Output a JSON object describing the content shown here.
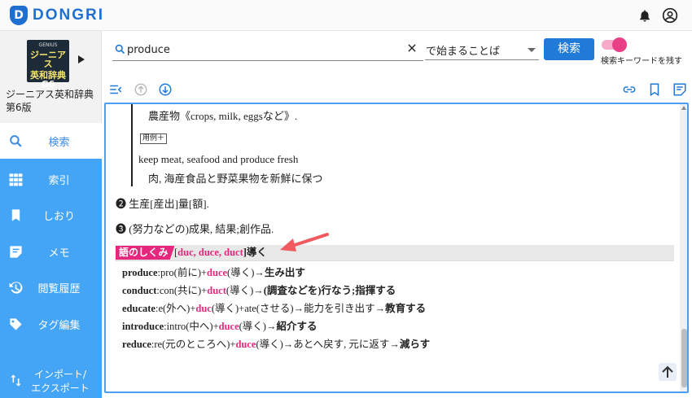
{
  "app": {
    "name": "DONGRI",
    "logo_letter": "D"
  },
  "dictionary": {
    "cover_top": "GENIUS",
    "cover_line1": "ジーニアス",
    "cover_line2": "英和辞典",
    "cover_line3": "G6",
    "name_line1": "ジーニアス英和辞典",
    "name_line2": "第6版"
  },
  "nav": [
    {
      "label": "検索",
      "icon": "search-icon",
      "active": true
    },
    {
      "label": "索引",
      "icon": "grid-icon"
    },
    {
      "label": "しおり",
      "icon": "bookmark-icon"
    },
    {
      "label": "メモ",
      "icon": "memo-icon"
    },
    {
      "label": "閲覧履歴",
      "icon": "history-icon"
    },
    {
      "label": "タグ編集",
      "icon": "tag-icon"
    },
    {
      "label_line1": "インポート/",
      "label_line2": "エクスポート",
      "icon": "import-export-icon"
    }
  ],
  "search": {
    "value": "produce",
    "mode": "で始まることば",
    "button": "検索",
    "keep_keyword_label": "検索キーワードを残す",
    "keep_keyword_on": true
  },
  "entry": {
    "line_crops": "農産物《crops, milk, eggsなど》.",
    "example_tag": "用例＋",
    "example_en": "keep meat, seafood and produce fresh",
    "example_ja": "肉, 海産食品と野菜果物を新鮮に保つ",
    "sense2_num": "❷",
    "sense2": "生産[産出]量[額].",
    "sense3_num": "❸",
    "sense3": "(努力などの)成果, 結果;創作品.",
    "ety_badge": "語のしくみ",
    "ety_open": "[",
    "ety_roots": "duc, duce, duct",
    "ety_close": "]導く",
    "ety_rows": [
      {
        "word": "produce",
        "a": ":pro(前に)+",
        "root": "duce",
        "b": "(導く)→",
        "result": "生み出す"
      },
      {
        "word": "conduct",
        "a": ":con(共に)+",
        "root": "duct",
        "b": "(導く)→",
        "result": "(調査などを)行なう;指揮する"
      },
      {
        "word": "educate",
        "a": ":e(外へ)+",
        "root": "duc",
        "b": "(導く)+ate(させる)→能力を引き出す→",
        "result": "教育する"
      },
      {
        "word": "introduce",
        "a": ":intro(中へ)+",
        "root": "duce",
        "b": "(導く)→",
        "result": "紹介する"
      },
      {
        "word": "reduce",
        "a": ":re(元のところへ)+",
        "root": "duce",
        "b": "(導く)→あとへ戻す, 元に返す→",
        "result": "減らす"
      }
    ]
  },
  "colors": {
    "accent": "#1f7ad8",
    "sidebar": "#44a4f5",
    "pink": "#e5277d"
  }
}
